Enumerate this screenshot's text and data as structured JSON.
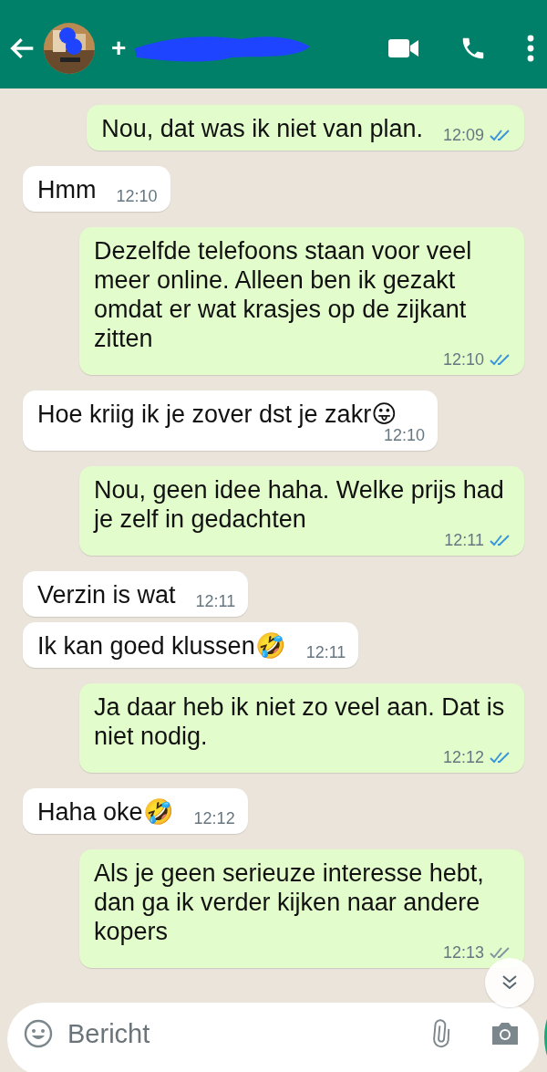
{
  "header": {
    "contact": "+"
  },
  "messages": [
    {
      "kind": "out",
      "text": "Nou, dat was ik niet van plan.",
      "time": "12:09",
      "read": true
    },
    {
      "kind": "in",
      "text": "Hmm",
      "time": "12:10"
    },
    {
      "kind": "out",
      "text": "Dezelfde telefoons staan voor veel meer online. Alleen ben ik gezakt omdat er wat krasjes op de zijkant zitten",
      "time": "12:10",
      "read": true
    },
    {
      "kind": "in",
      "text": "Hoe kriig ik je zover dst je zakr",
      "emoji": "😛",
      "time": "12:10"
    },
    {
      "kind": "out",
      "text": "Nou, geen idee haha. Welke prijs had je zelf in gedachten",
      "time": "12:11",
      "read": true
    },
    {
      "kind": "in",
      "text": "Verzin is wat",
      "time": "12:11"
    },
    {
      "kind": "in",
      "text": "Ik kan goed klussen",
      "emoji": "🤣",
      "time": "12:11"
    },
    {
      "kind": "out",
      "text": "Ja daar heb ik niet zo veel aan. Dat is niet nodig.",
      "time": "12:12",
      "read": true
    },
    {
      "kind": "in",
      "text": "Haha oke",
      "emoji": "🤣",
      "time": "12:12"
    },
    {
      "kind": "out",
      "text": "Als je geen serieuze interesse hebt, dan ga ik verder kijken naar andere kopers",
      "time": "12:13",
      "read": false
    }
  ],
  "composer": {
    "placeholder": "Bericht"
  }
}
